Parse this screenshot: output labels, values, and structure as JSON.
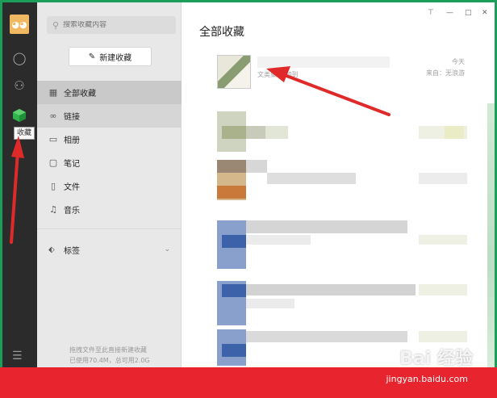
{
  "sidebar": {
    "search_placeholder": "搜索收藏内容",
    "new_button": "新建收藏",
    "items": [
      {
        "label": "全部收藏",
        "icon": "grid-icon"
      },
      {
        "label": "链接",
        "icon": "link-icon"
      },
      {
        "label": "相册",
        "icon": "image-icon"
      },
      {
        "label": "笔记",
        "icon": "note-icon"
      },
      {
        "label": "文件",
        "icon": "file-icon"
      },
      {
        "label": "音乐",
        "icon": "music-icon"
      }
    ],
    "tags_label": "标签",
    "storage_hint": "拖拽文件至此直接新建收藏",
    "storage_usage": "已使用70.4M，总可用2.0G"
  },
  "rail": {
    "tooltip": "收藏"
  },
  "main": {
    "title": "全部收藏",
    "first_item": {
      "subtext": "文类聚享 加到",
      "date": "今天",
      "source": "来自：无浪游"
    }
  },
  "watermark": {
    "brand": "Bai 经验",
    "url": "jingyan.baidu.com"
  },
  "colors": {
    "frame": "#1a9e5a",
    "rail": "#2b2b2b",
    "band": "#e8242e",
    "arrow": "#e02a2a"
  }
}
